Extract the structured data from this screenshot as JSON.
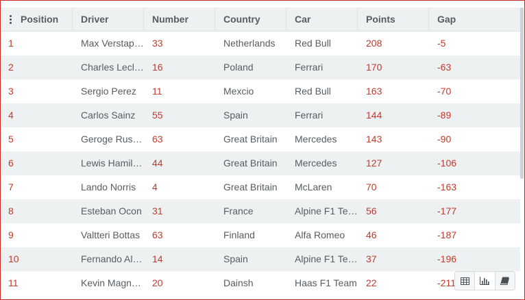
{
  "columns": {
    "position": "Position",
    "driver": "Driver",
    "number": "Number",
    "country": "Country",
    "car": "Car",
    "points": "Points",
    "gap": "Gap"
  },
  "rows": [
    {
      "position": "1",
      "driver": "Max Verstap…",
      "number": "33",
      "country": "Netherlands",
      "car": "Red Bull",
      "points": "208",
      "gap": "-5"
    },
    {
      "position": "2",
      "driver": "Charles Lecl…",
      "number": "16",
      "country": "Poland",
      "car": "Ferrari",
      "points": "170",
      "gap": "-63"
    },
    {
      "position": "3",
      "driver": "Sergio Perez",
      "number": "11",
      "country": "Mexcio",
      "car": "Red Bull",
      "points": "163",
      "gap": "-70"
    },
    {
      "position": "4",
      "driver": "Carlos Sainz",
      "number": "55",
      "country": "Spain",
      "car": "Ferrari",
      "points": "144",
      "gap": "-89"
    },
    {
      "position": "5",
      "driver": "Geroge Rus…",
      "number": "63",
      "country": "Great Britain",
      "car": "Mercedes",
      "points": "143",
      "gap": "-90"
    },
    {
      "position": "6",
      "driver": "Lewis Hamilt…",
      "number": "44",
      "country": "Great Britain",
      "car": "Mercedes",
      "points": "127",
      "gap": "-106"
    },
    {
      "position": "7",
      "driver": "Lando Norris",
      "number": "4",
      "country": "Great Britain",
      "car": "McLaren",
      "points": "70",
      "gap": "-163"
    },
    {
      "position": "8",
      "driver": "Esteban Ocon",
      "number": "31",
      "country": "France",
      "car": "Alpine F1 Te…",
      "points": "56",
      "gap": "-177"
    },
    {
      "position": "9",
      "driver": "Valtteri Bottas",
      "number": "63",
      "country": "Finland",
      "car": "Alfa Romeo",
      "points": "46",
      "gap": "-187"
    },
    {
      "position": "10",
      "driver": "Fernando Al…",
      "number": "14",
      "country": "Spain",
      "car": "Alpine F1 Te…",
      "points": "37",
      "gap": "-196"
    },
    {
      "position": "11",
      "driver": "Kevin Magn…",
      "number": "20",
      "country": "Dainsh",
      "car": "Haas F1 Team",
      "points": "22",
      "gap": "-211"
    }
  ],
  "toolbar": {
    "buttons": [
      {
        "icon": "table-icon",
        "active": false
      },
      {
        "icon": "bar-chart-icon",
        "active": true
      },
      {
        "icon": "book-icon",
        "active": false
      }
    ]
  },
  "colors": {
    "accent_red": "#c0392b",
    "border_red": "#c62828",
    "text_gray": "#555d62",
    "row_alt": "#eef1f2"
  }
}
